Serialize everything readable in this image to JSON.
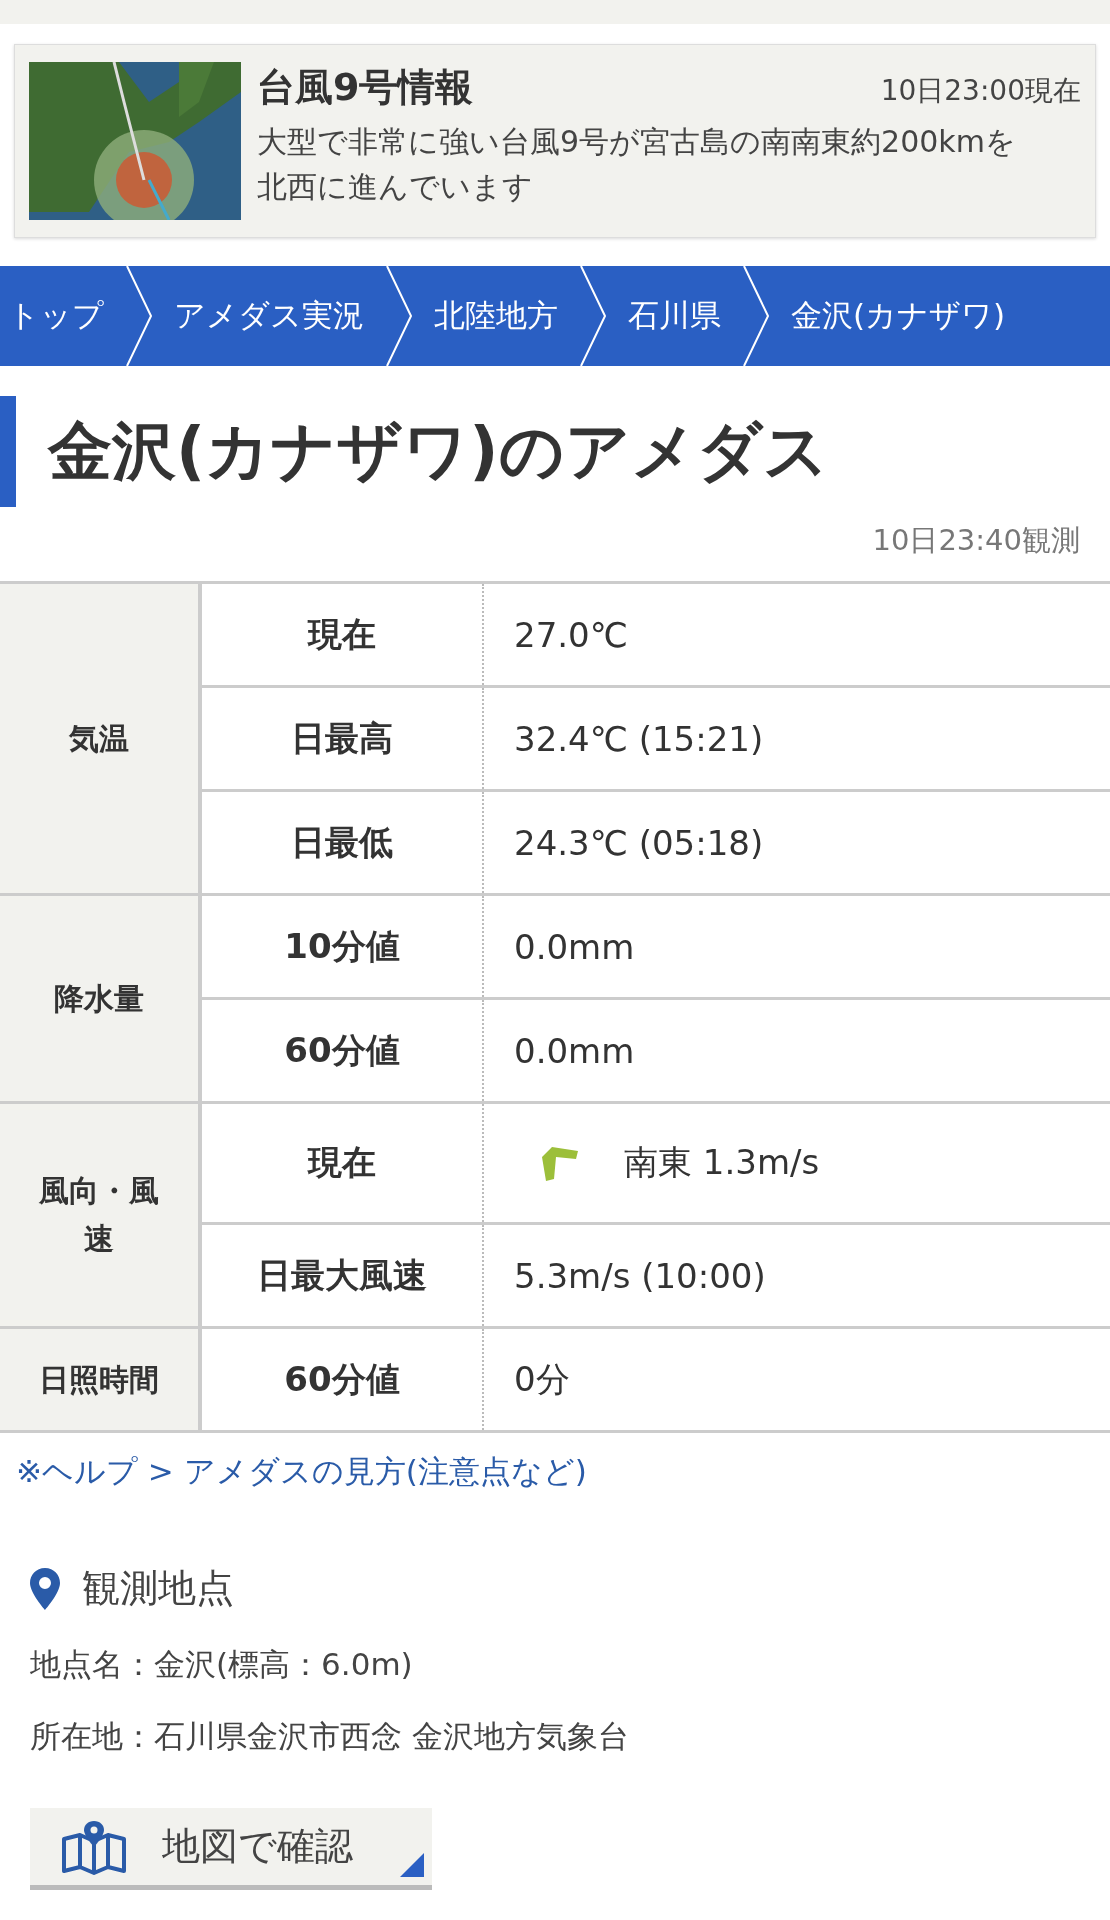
{
  "typhoon_card": {
    "kind": "picture",
    "title": "台風9号情報",
    "time": "10日23:00現在",
    "text": "大型で非常に強い台風9号が宮古島の南南東約200kmを北西に進んでいます"
  },
  "breadcrumb": [
    "トップ",
    "アメダス実況",
    "北陸地方",
    "石川県",
    "金沢(カナザワ)"
  ],
  "heading": "金沢(カナザワ)のアメダス",
  "observed_time": "10日23:40観測",
  "table": [
    {
      "label": "気温",
      "rows": [
        {
          "kind": "plain",
          "name": "現在",
          "value": "27.0℃"
        },
        {
          "kind": "plain",
          "name": "日最高",
          "value": "32.4℃ (15:21)"
        },
        {
          "kind": "plain",
          "name": "日最低",
          "value": "24.3℃ (05:18)"
        }
      ]
    },
    {
      "label": "降水量",
      "rows": [
        {
          "kind": "plain",
          "name": "10分値",
          "value": "0.0mm"
        },
        {
          "kind": "plain",
          "name": "60分値",
          "value": "0.0mm"
        }
      ]
    },
    {
      "label": "風向・風速",
      "rows": [
        {
          "kind": "wind",
          "name": "現在",
          "value": "南東 1.3m/s"
        },
        {
          "kind": "plain",
          "name": "日最大風速",
          "value": "5.3m/s (10:00)"
        }
      ]
    },
    {
      "label": "日照時間",
      "rows": [
        {
          "kind": "plain",
          "name": "60分値",
          "value": "0分"
        }
      ]
    }
  ],
  "help_link": "※ヘルプ > アメダスの見方(注意点など)",
  "station": {
    "title": "観測地点",
    "name": "地点名：金沢(標高：6.0m)",
    "address": "所在地：石川県金沢市西念 金沢地方気象台",
    "map_button": "地図で確認"
  }
}
